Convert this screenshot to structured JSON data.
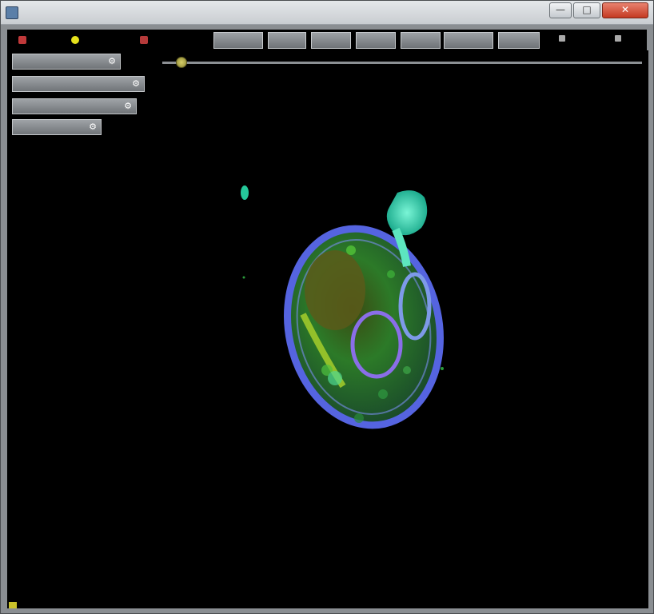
{
  "window": {
    "title": "",
    "controls": {
      "minimize": "—",
      "maximize": "□",
      "close": "✕"
    }
  },
  "toolbar": {
    "icons": [
      "record-icon",
      "light-icon",
      "stop-icon"
    ],
    "tabs": [
      "",
      "",
      "",
      "",
      "",
      "",
      ""
    ]
  },
  "side_panel": {
    "buttons": [
      {
        "label": "",
        "icon": "⚙"
      },
      {
        "label": "",
        "icon": "⚙"
      },
      {
        "label": "",
        "icon": "⚙"
      },
      {
        "label": "",
        "icon": "⚙"
      }
    ]
  },
  "time_slider": {
    "value": 0.04
  },
  "status": {
    "text": ""
  },
  "colors": {
    "background": "#000000",
    "membrane": "#4a5bd6",
    "cytoplasm": "#2f8a2a",
    "nucleus": "#7ea81e",
    "bud": "#28e0b4"
  }
}
